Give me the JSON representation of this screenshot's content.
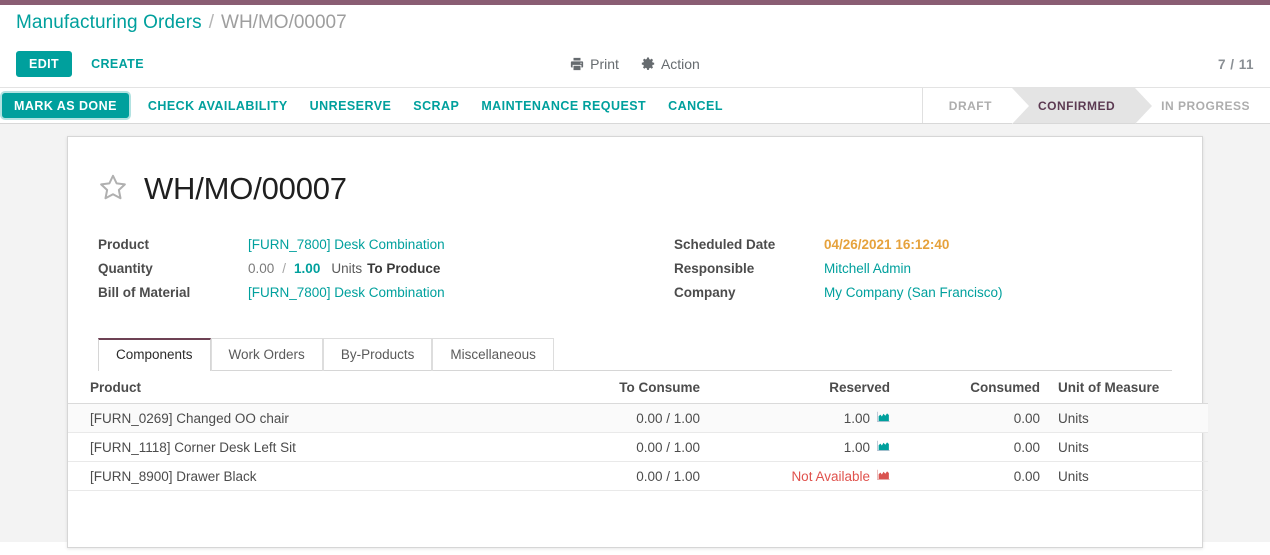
{
  "theme": {
    "accent_teal": "#00a09d",
    "accent_plum": "#8a5d73",
    "status_active_text": "#5c3a52",
    "orange": "#e6a23c",
    "danger_red": "#e0524d"
  },
  "breadcrumb": {
    "root": "Manufacturing Orders",
    "separator": "/",
    "current": "WH/MO/00007"
  },
  "control_panel": {
    "edit_label": "EDIT",
    "create_label": "CREATE",
    "print_label": "Print",
    "print_icon": "printer-icon",
    "action_label": "Action",
    "action_icon": "gear-icon",
    "pager": "7 / 11"
  },
  "statusbar": {
    "buttons": [
      {
        "label": "MARK AS DONE",
        "primary": true
      },
      {
        "label": "CHECK AVAILABILITY",
        "primary": false
      },
      {
        "label": "UNRESERVE",
        "primary": false
      },
      {
        "label": "SCRAP",
        "primary": false
      },
      {
        "label": "MAINTENANCE REQUEST",
        "primary": false
      },
      {
        "label": "CANCEL",
        "primary": false
      }
    ],
    "stages": [
      {
        "label": "DRAFT",
        "active": false
      },
      {
        "label": "CONFIRMED",
        "active": true
      },
      {
        "label": "IN PROGRESS",
        "active": false
      }
    ]
  },
  "record": {
    "favorite_icon": "star-outline-icon",
    "title": "WH/MO/00007",
    "left_fields": [
      {
        "label": "Product",
        "value": "[FURN_7800] Desk Combination",
        "style": "link"
      },
      {
        "label": "Quantity",
        "value": "",
        "style": "quantity"
      },
      {
        "label": "Bill of Material",
        "value": "[FURN_7800] Desk Combination",
        "style": "link"
      }
    ],
    "quantity": {
      "done": "0.00",
      "separator": "/",
      "target": "1.00",
      "uom": "Units",
      "state": "To Produce"
    },
    "right_fields": [
      {
        "label": "Scheduled Date",
        "value": "04/26/2021 16:12:40",
        "style": "orange"
      },
      {
        "label": "Responsible",
        "value": "Mitchell Admin",
        "style": "link"
      },
      {
        "label": "Company",
        "value": "My Company (San Francisco)",
        "style": "link"
      }
    ]
  },
  "notebook": {
    "tabs": [
      {
        "label": "Components",
        "active": true
      },
      {
        "label": "Work Orders",
        "active": false
      },
      {
        "label": "By-Products",
        "active": false
      },
      {
        "label": "Miscellaneous",
        "active": false
      }
    ]
  },
  "components_table": {
    "columns": [
      "Product",
      "To Consume",
      "Reserved",
      "Consumed",
      "Unit of Measure"
    ],
    "rows": [
      {
        "product": "[FURN_0269] Changed OO chair",
        "to_consume": "0.00 / 1.00",
        "reserved": "1.00",
        "reserved_available": true,
        "forecast_icon": "area-chart-icon",
        "consumed": "0.00",
        "uom": "Units"
      },
      {
        "product": "[FURN_1118] Corner Desk Left Sit",
        "to_consume": "0.00 / 1.00",
        "reserved": "1.00",
        "reserved_available": true,
        "forecast_icon": "area-chart-icon",
        "consumed": "0.00",
        "uom": "Units"
      },
      {
        "product": "[FURN_8900] Drawer Black",
        "to_consume": "0.00 / 1.00",
        "reserved": "Not Available",
        "reserved_available": false,
        "forecast_icon": "area-chart-icon",
        "consumed": "0.00",
        "uom": "Units"
      }
    ]
  }
}
